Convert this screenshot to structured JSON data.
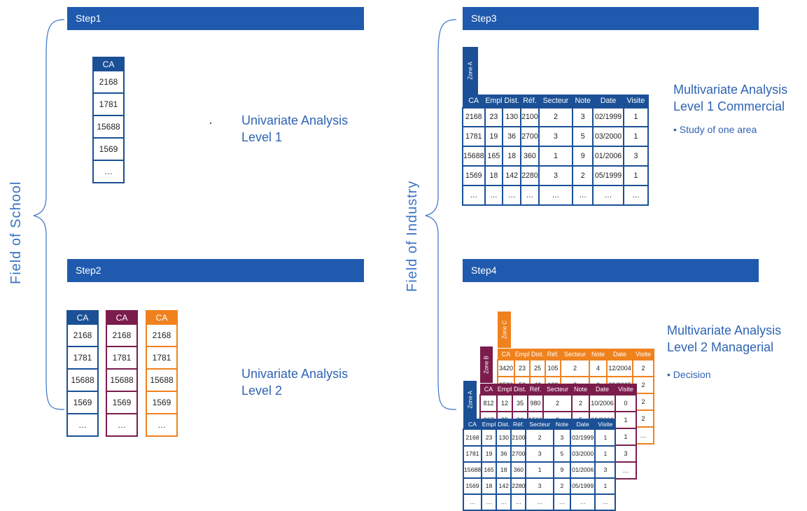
{
  "left_field_label": "Field of School",
  "right_field_label": "Field of Industry",
  "steps": {
    "step1": "Step1",
    "step2": "Step2",
    "step3": "Step3",
    "step4": "Step4"
  },
  "step1": {
    "analysis_line1": "Univariate Analysis",
    "analysis_line2": "Level 1",
    "column": {
      "header": "CA",
      "values": [
        "2168",
        "1781",
        "15688",
        "1569",
        "…"
      ]
    }
  },
  "step2": {
    "analysis_line1": "Univariate Analysis",
    "analysis_line2": "Level 2",
    "columns": [
      {
        "header": "CA",
        "values": [
          "2168",
          "1781",
          "15688",
          "1569",
          "…"
        ],
        "color": "#1b5096"
      },
      {
        "header": "CA",
        "values": [
          "2168",
          "1781",
          "15688",
          "1569",
          "…"
        ],
        "color": "#7b1c4c"
      },
      {
        "header": "CA",
        "values": [
          "2168",
          "1781",
          "15688",
          "1569",
          "…"
        ],
        "color": "#f0821e"
      }
    ]
  },
  "step3": {
    "analysis_line1": "Multivariate Analysis",
    "analysis_line2": "Level 1 Commercial",
    "bullet": "• Study of one area",
    "zone": "Zone A",
    "headers": [
      "CA",
      "Empl",
      "Dist.",
      "Réf.",
      "Secteur",
      "Note",
      "Date",
      "Visite"
    ],
    "rows": [
      [
        "2168",
        "23",
        "130",
        "2100",
        "2",
        "3",
        "02/1999",
        "1"
      ],
      [
        "1781",
        "19",
        "36",
        "2700",
        "3",
        "5",
        "03/2000",
        "1"
      ],
      [
        "15688",
        "165",
        "18",
        "360",
        "1",
        "9",
        "01/2006",
        "3"
      ],
      [
        "1569",
        "18",
        "142",
        "2280",
        "3",
        "2",
        "05/1999",
        "1"
      ],
      [
        "…",
        "…",
        "…",
        "…",
        "…",
        "…",
        "…",
        "…"
      ]
    ]
  },
  "step4": {
    "analysis_line1": "Multivariate Analysis",
    "analysis_line2": "Level 2 Managerial",
    "bullet": "• Decision",
    "zone_c": {
      "zone": "Zone C",
      "color": "#f0821e",
      "headers": [
        "CA",
        "Empl",
        "Dist.",
        "Réf.",
        "Secteur",
        "Note",
        "Date",
        "Visite"
      ],
      "rows": [
        [
          "3420",
          "23",
          "25",
          "105",
          "2",
          "4",
          "12/2004",
          "2"
        ],
        [
          "3530",
          "58",
          "48",
          "132",
          "2",
          "6",
          "03/2005",
          "2"
        ],
        [
          "",
          "",
          "",
          "",
          "",
          "",
          "",
          "2"
        ],
        [
          "",
          "",
          "",
          "",
          "",
          "",
          "",
          "2"
        ],
        [
          "",
          "",
          "",
          "",
          "",
          "",
          "",
          "…"
        ]
      ]
    },
    "zone_b": {
      "zone": "Zone B",
      "color": "#7b1c4c",
      "headers": [
        "CA",
        "Empl",
        "Dist.",
        "Réf.",
        "Secteur",
        "Note",
        "Date",
        "Visite"
      ],
      "rows": [
        [
          "812",
          "12",
          "35",
          "980",
          "2",
          "2",
          "10/2006",
          "0"
        ],
        [
          "807",
          "25",
          "26",
          "1500",
          "3",
          "5",
          "02/2006",
          "1"
        ],
        [
          "",
          "",
          "",
          "",
          "",
          "",
          "",
          "1"
        ],
        [
          "",
          "",
          "",
          "",
          "",
          "",
          "",
          "3"
        ],
        [
          "",
          "",
          "",
          "",
          "",
          "",
          "",
          "…"
        ]
      ]
    },
    "zone_a": {
      "zone": "Zone A",
      "color": "#1b5096",
      "headers": [
        "CA",
        "Empl",
        "Dist.",
        "Réf.",
        "Secteur",
        "Note",
        "Date",
        "Visite"
      ],
      "rows": [
        [
          "2168",
          "23",
          "130",
          "2100",
          "2",
          "3",
          "02/1999",
          "1"
        ],
        [
          "1781",
          "19",
          "36",
          "2700",
          "3",
          "5",
          "03/2000",
          "1"
        ],
        [
          "15688",
          "165",
          "18",
          "360",
          "1",
          "9",
          "01/2006",
          "3"
        ],
        [
          "1569",
          "18",
          "142",
          "2280",
          "3",
          "2",
          "05/1999",
          "1"
        ],
        [
          "…",
          "…",
          "…",
          "…",
          "…",
          "…",
          "…",
          "…"
        ]
      ]
    }
  }
}
